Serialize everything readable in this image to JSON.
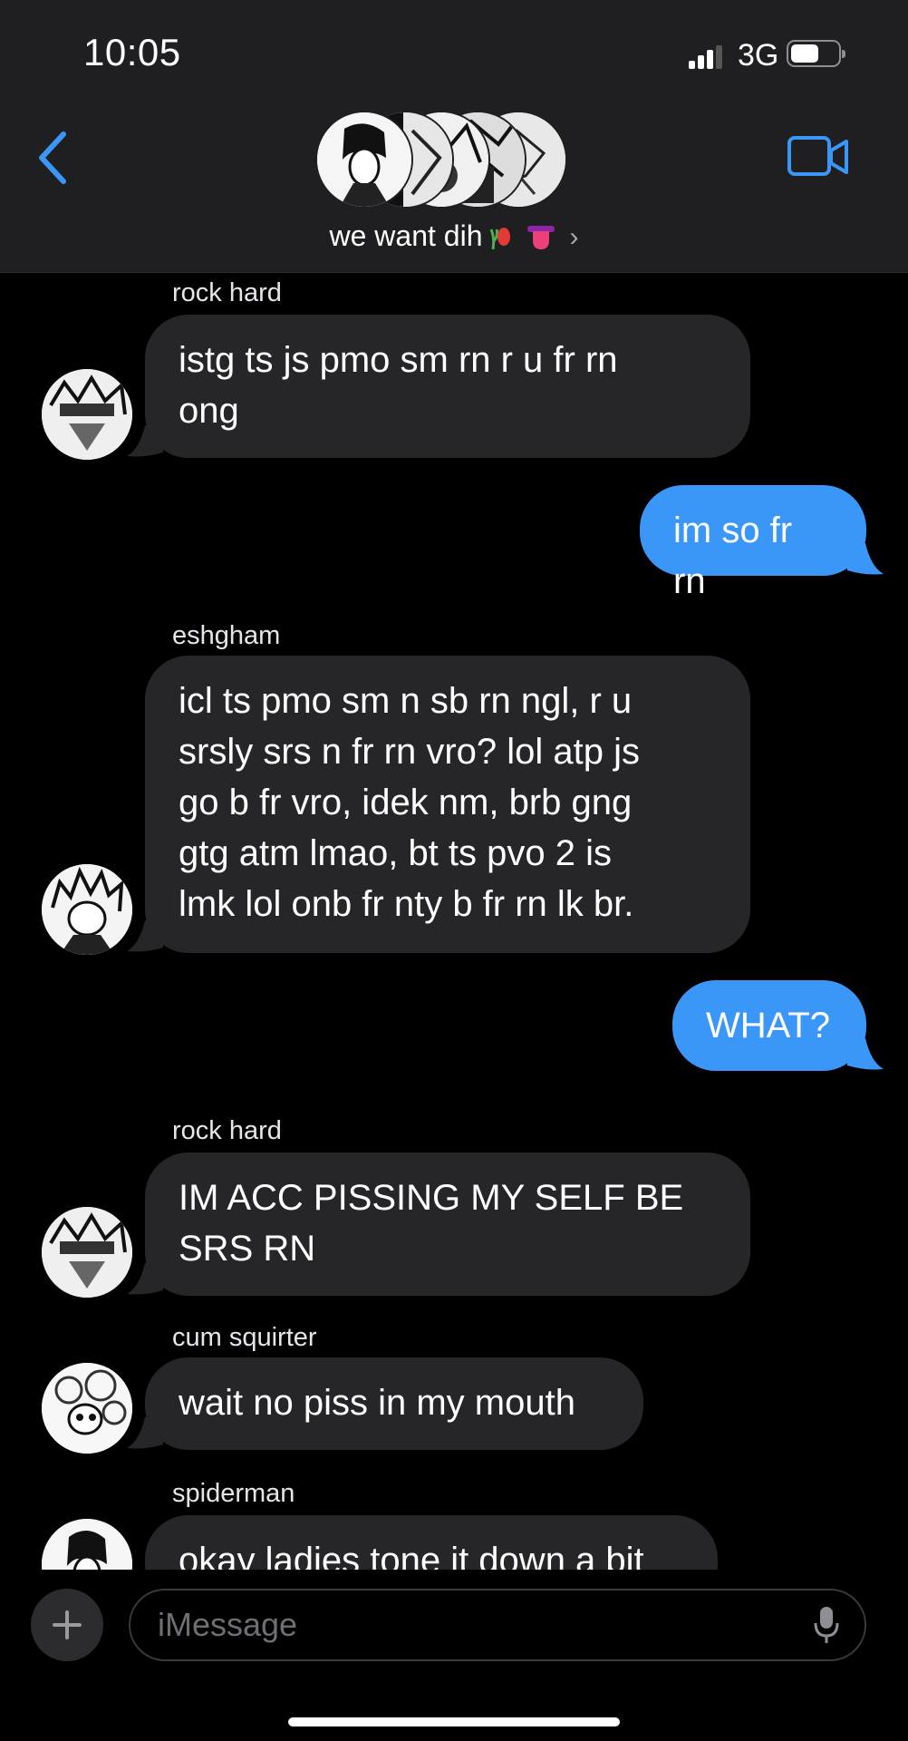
{
  "status_bar": {
    "time": "10:05",
    "network": "3G"
  },
  "header": {
    "group_name": "we want dih",
    "accent_color": "#3b97f7"
  },
  "messages": [
    {
      "direction": "incoming",
      "sender": "rock hard",
      "lines": [
        "istg ts js pmo sm rn r u fr rn",
        "ong"
      ]
    },
    {
      "direction": "outgoing",
      "lines": [
        "im so fr rn"
      ]
    },
    {
      "direction": "incoming",
      "sender": "eshgham",
      "lines": [
        "icl ts pmo sm n sb rn ngl, r u",
        "srsly srs n fr rn vro? lol atp js",
        "go b fr vro, idek nm, brb gng",
        "gtg atm lmao, bt ts pvo 2 is",
        "lmk lol onb fr nty b fr rn lk br."
      ]
    },
    {
      "direction": "outgoing",
      "lines": [
        "WHAT?"
      ]
    },
    {
      "direction": "incoming",
      "sender": "rock hard",
      "lines": [
        "IM ACC PISSING MY SELF BE",
        "SRS RN"
      ]
    },
    {
      "direction": "incoming",
      "sender": "cum squirter",
      "lines": [
        "wait no piss in my mouth"
      ]
    },
    {
      "direction": "incoming",
      "sender": "spiderman",
      "lines": [
        "okay ladies tone it down a bit"
      ]
    }
  ],
  "compose": {
    "placeholder": "iMessage"
  },
  "colors": {
    "incoming_bubble": "#262629",
    "outgoing_bubble": "#3b97f7",
    "header_bg": "#1f1f21"
  }
}
